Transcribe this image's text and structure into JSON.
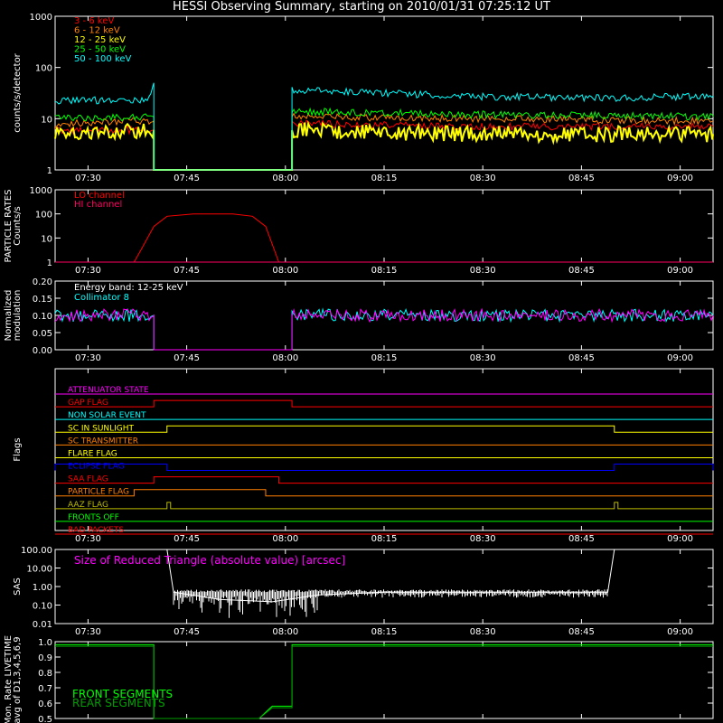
{
  "title": "HESSI Observing Summary, starting on 2010/01/31 07:25:12 UT",
  "time_ticks": [
    "07:30",
    "07:45",
    "08:00",
    "08:15",
    "08:30",
    "08:45",
    "09:00"
  ],
  "colors": {
    "red": "#ff0000",
    "orange": "#ff8000",
    "yellow": "#ffff00",
    "green": "#00ff00",
    "cyan": "#00ffff",
    "magenta": "#ff00ff",
    "crimson": "#ff0060",
    "blue": "#0000ff",
    "olive": "#bbbb00",
    "white": "#ffffff",
    "darkgreen": "#00a000"
  },
  "chart_data": [
    {
      "type": "line",
      "ylabel": "counts/s/detector",
      "yscale": "log",
      "ylim": [
        1,
        1000
      ],
      "yticks": [
        "1",
        "10",
        "100",
        "1000"
      ],
      "series": [
        {
          "name": "3 - 6 keV",
          "color": "#ff0000",
          "x": [
            "07:25",
            "07:40",
            "07:40",
            "08:01",
            "08:01",
            "08:30",
            "09:05"
          ],
          "values": [
            6,
            6,
            1,
            1,
            8,
            7,
            7
          ]
        },
        {
          "name": "6 - 12 keV",
          "color": "#ff8000",
          "x": [
            "07:25",
            "07:40",
            "07:40",
            "08:01",
            "08:01",
            "08:30",
            "09:05"
          ],
          "values": [
            8,
            9,
            1,
            1,
            11,
            10,
            9
          ]
        },
        {
          "name": "12 - 25 keV",
          "color": "#ffff00",
          "x": [
            "07:25",
            "07:40",
            "07:40",
            "08:01",
            "08:01",
            "08:30",
            "09:05"
          ],
          "values": [
            5,
            6,
            1,
            1,
            6,
            5,
            5
          ]
        },
        {
          "name": "25 - 50 keV",
          "color": "#00ff00",
          "x": [
            "07:25",
            "07:40",
            "07:40",
            "08:01",
            "08:01",
            "08:30",
            "09:05"
          ],
          "values": [
            10,
            11,
            1,
            1,
            14,
            12,
            11
          ]
        },
        {
          "name": "50 - 100 keV",
          "color": "#00ffff",
          "x": [
            "07:25",
            "07:39",
            "07:40",
            "07:40",
            "08:01",
            "08:01",
            "08:30",
            "08:50",
            "09:05"
          ],
          "values": [
            22,
            24,
            50,
            1,
            1,
            36,
            27,
            25,
            28
          ]
        }
      ]
    },
    {
      "type": "line",
      "ylabel": "PARTICLE RATES Counts/s",
      "yscale": "log",
      "ylim": [
        1,
        1000
      ],
      "yticks": [
        "1",
        "10",
        "100",
        "1000"
      ],
      "series": [
        {
          "name": "LO channel",
          "color": "#ff0000",
          "x": [
            "07:25",
            "07:37",
            "07:38",
            "07:40",
            "07:42",
            "07:46",
            "07:52",
            "07:55",
            "07:57",
            "07:59",
            "09:05"
          ],
          "values": [
            1,
            1,
            3,
            30,
            80,
            100,
            100,
            80,
            30,
            1,
            1
          ]
        },
        {
          "name": "HI channel",
          "color": "#ff0060",
          "x": [
            "07:25",
            "09:05"
          ],
          "values": [
            1,
            1
          ]
        }
      ]
    },
    {
      "type": "line",
      "ylabel": "Normalized modulation",
      "annotation": "Energy band: 12-25 keV",
      "ylim": [
        0.0,
        0.2
      ],
      "yticks": [
        "0.00",
        "0.05",
        "0.10",
        "0.15",
        "0.20"
      ],
      "series": [
        {
          "name": "Collimator 8",
          "color": "#00ffff",
          "x": [
            "07:25",
            "07:40",
            "07:40",
            "08:01",
            "08:01",
            "09:05"
          ],
          "values": [
            0.1,
            0.1,
            0.0,
            0.0,
            0.1,
            0.1
          ]
        },
        {
          "color": "#ff00ff",
          "x": [
            "07:25",
            "07:40",
            "07:40",
            "08:01",
            "08:01",
            "09:05"
          ],
          "values": [
            0.1,
            0.1,
            0.0,
            0.0,
            0.1,
            0.1
          ]
        }
      ]
    },
    {
      "type": "line",
      "ylabel": "Flags",
      "flags": [
        {
          "name": "ATTENUATOR STATE",
          "color": "#ff00ff",
          "on": []
        },
        {
          "name": "GAP FLAG",
          "color": "#ff0000",
          "on": [
            [
              "07:40",
              "08:01"
            ]
          ]
        },
        {
          "name": "NON SOLAR EVENT",
          "color": "#00ffff",
          "on": []
        },
        {
          "name": "SC IN SUNLIGHT",
          "color": "#ffff00",
          "on": [
            [
              "07:42",
              "08:50"
            ]
          ]
        },
        {
          "name": "SC TRANSMITTER",
          "color": "#ff8000",
          "on": []
        },
        {
          "name": "FLARE FLAG",
          "color": "#ffff00",
          "on": []
        },
        {
          "name": "ECLIPSE FLAG",
          "color": "#0000ff",
          "on": [
            [
              "07:25",
              "07:42"
            ],
            [
              "08:50",
              "09:05"
            ]
          ]
        },
        {
          "name": "SAA FLAG",
          "color": "#ff0000",
          "on": [
            [
              "07:40",
              "07:59"
            ]
          ]
        },
        {
          "name": "PARTICLE FLAG",
          "color": "#ff8000",
          "on": [
            [
              "07:37",
              "07:57"
            ]
          ]
        },
        {
          "name": "AAZ FLAG",
          "color": "#bbbb00",
          "on": [
            [
              "07:42",
              "07:42"
            ],
            [
              "08:50",
              "08:50"
            ]
          ]
        },
        {
          "name": "FRONTS OFF",
          "color": "#00ff00",
          "on": []
        },
        {
          "name": "BAD PACKETS",
          "color": "#ff0000",
          "on": []
        }
      ]
    },
    {
      "type": "line",
      "ylabel": "SAS",
      "annotation": "Size of Reduced Triangle (absolute value) [arcsec]",
      "yscale": "log",
      "ylim": [
        0.01,
        100
      ],
      "yticks": [
        "0.01",
        "0.10",
        "1.00",
        "10.00",
        "100.00"
      ],
      "series": [
        {
          "color": "#ffffff",
          "x": [
            "07:42",
            "07:43",
            "07:50",
            "07:58",
            "08:05",
            "08:15",
            "08:30",
            "08:49",
            "08:50"
          ],
          "values": [
            100,
            0.5,
            0.2,
            0.15,
            0.35,
            0.5,
            0.5,
            0.5,
            100
          ]
        }
      ]
    },
    {
      "type": "line",
      "ylabel": "Mon. Rate LIVETIME avg of D1,3,4,5,6,9",
      "ylim": [
        0.5,
        1.0
      ],
      "yticks": [
        "0.5",
        "0.6",
        "0.7",
        "0.8",
        "0.9",
        "1.0"
      ],
      "series": [
        {
          "name": "FRONT SEGMENTS",
          "color": "#00ff00",
          "x": [
            "07:25",
            "07:40",
            "07:40",
            "07:56",
            "07:58",
            "08:01",
            "08:01",
            "09:05"
          ],
          "values": [
            0.98,
            0.98,
            0.5,
            0.5,
            0.58,
            0.58,
            0.98,
            0.98
          ]
        },
        {
          "name": "REAR SEGMENTS",
          "color": "#00a000",
          "x": [
            "07:25",
            "07:40",
            "07:40",
            "07:56",
            "07:58",
            "08:01",
            "08:01",
            "09:05"
          ],
          "values": [
            0.97,
            0.97,
            0.5,
            0.5,
            0.57,
            0.57,
            0.97,
            0.97
          ]
        }
      ]
    }
  ]
}
